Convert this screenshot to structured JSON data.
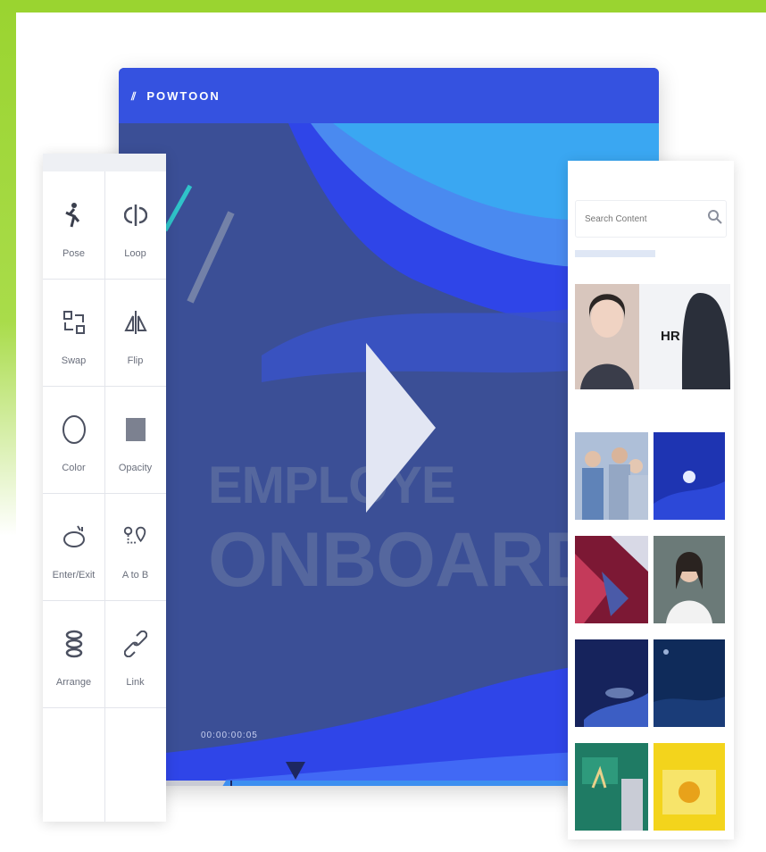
{
  "app": {
    "brand": "POWTOON"
  },
  "video": {
    "title_line_1": "EMPLOYE",
    "title_line_2": "ONBOARDIN",
    "timecode": "00:00:00:05"
  },
  "tools": [
    {
      "label": "Pose",
      "icon": "pose-figure-icon"
    },
    {
      "label": "Loop",
      "icon": "loop-icon"
    },
    {
      "label": "Swap",
      "icon": "swap-icon"
    },
    {
      "label": "Flip",
      "icon": "flip-icon"
    },
    {
      "label": "Color",
      "icon": "color-circle-icon"
    },
    {
      "label": "Opacity",
      "icon": "opacity-icon"
    },
    {
      "label": "Enter/Exit",
      "icon": "enter-exit-icon"
    },
    {
      "label": "A to B",
      "icon": "a-to-b-icon"
    },
    {
      "label": "Arrange",
      "icon": "arrange-icon"
    },
    {
      "label": "Link",
      "icon": "link-icon"
    }
  ],
  "media": {
    "search_placeholder": "Search Content",
    "hr_label": "HR"
  },
  "colors": {
    "frame_green": "#9ad430",
    "title_bar": "#3552e0",
    "stage": "#3b4f96",
    "accent_blue": "#2f45e8"
  }
}
